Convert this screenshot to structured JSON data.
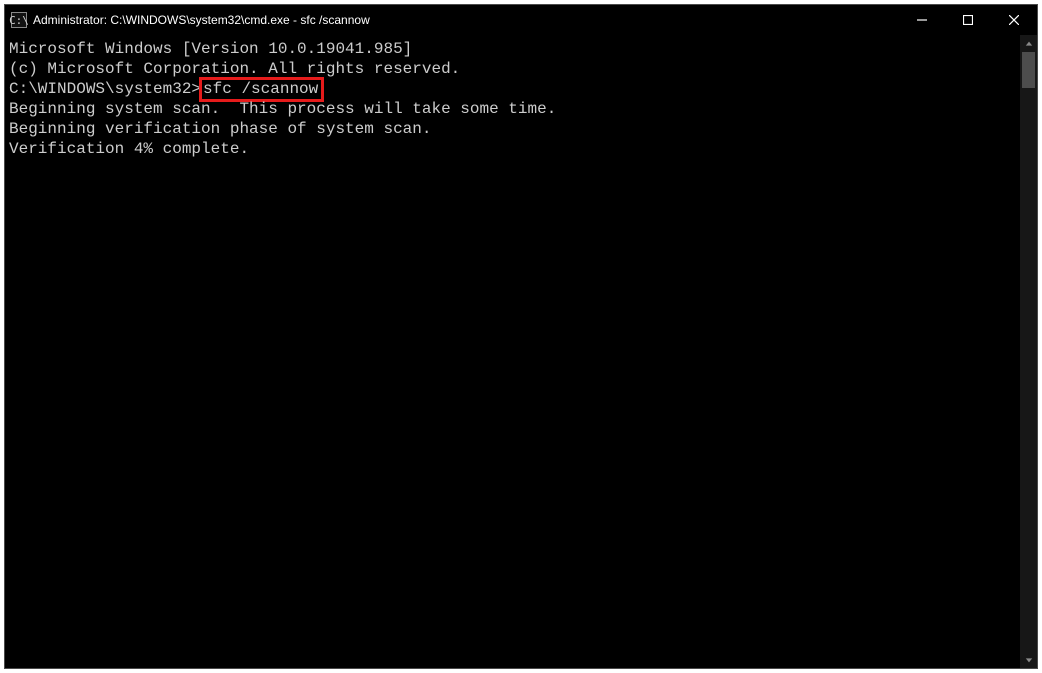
{
  "window": {
    "title": "Administrator: C:\\WINDOWS\\system32\\cmd.exe - sfc  /scannow",
    "icon_label": "C:\\"
  },
  "terminal": {
    "line_version": "Microsoft Windows [Version 10.0.19041.985]",
    "line_copyright": "(c) Microsoft Corporation. All rights reserved.",
    "blank": "",
    "prompt_prefix": "C:\\WINDOWS\\system32>",
    "prompt_cmd": "sfc /scannow",
    "line_begin_scan": "Beginning system scan.  This process will take some time.",
    "line_begin_verify": "Beginning verification phase of system scan.",
    "line_progress": "Verification 4% complete."
  }
}
